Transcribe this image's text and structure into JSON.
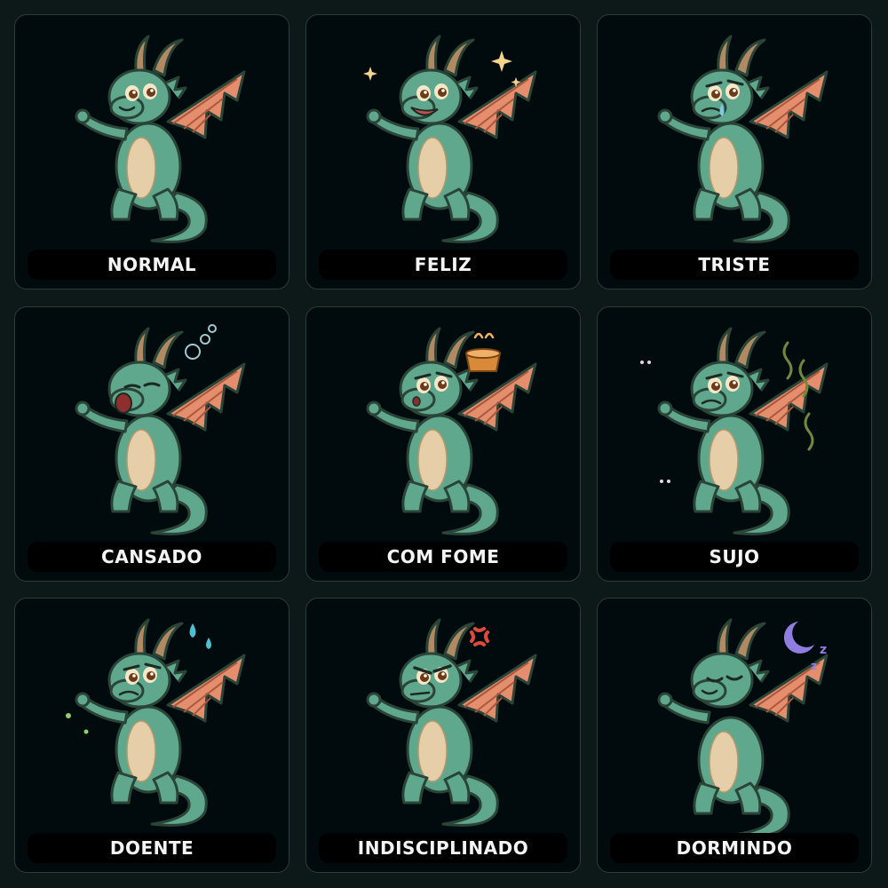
{
  "colors": {
    "background": "#0d1818",
    "card": "#010b0d",
    "card_border": "#2a3d3a",
    "dragon_body": "#5fa78d",
    "dragon_belly": "#e6cfa8",
    "dragon_wing": "#e58e6d",
    "dragon_horn": "#b08a63",
    "label_text": "#f4f4f4"
  },
  "states": [
    {
      "label": "NORMAL",
      "mood": "normal",
      "accessory": "none"
    },
    {
      "label": "FELIZ",
      "mood": "happy",
      "accessory": "sparkles-icon"
    },
    {
      "label": "TRISTE",
      "mood": "sad",
      "accessory": "tear-icon"
    },
    {
      "label": "CANSADO",
      "mood": "tired",
      "accessory": "bubbles-icon"
    },
    {
      "label": "COM FOME",
      "mood": "hungry",
      "accessory": "food-bowl-icon"
    },
    {
      "label": "SUJO",
      "mood": "dirty",
      "accessory": "stink-lines-icon"
    },
    {
      "label": "DOENTE",
      "mood": "sick",
      "accessory": "sweat-drops-icon"
    },
    {
      "label": "INDISCIPLINADO",
      "mood": "angry",
      "accessory": "anger-mark-icon"
    },
    {
      "label": "DORMINDO",
      "mood": "sleeping",
      "accessory": "moon-zzz-icon"
    }
  ]
}
